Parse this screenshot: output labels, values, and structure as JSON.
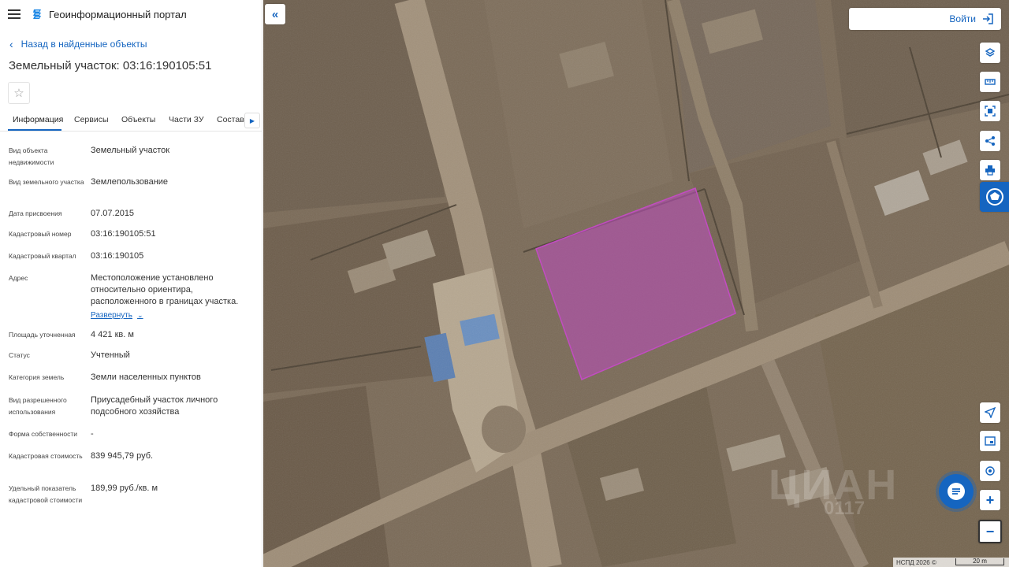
{
  "header": {
    "portal_title": "Геоинформационный портал"
  },
  "nav": {
    "back_label": "Назад в найденные объекты"
  },
  "parcel": {
    "title": "Земельный участок: 03:16:190105:51"
  },
  "tabs": [
    {
      "label": "Информация",
      "active": true
    },
    {
      "label": "Сервисы"
    },
    {
      "label": "Объекты"
    },
    {
      "label": "Части ЗУ"
    },
    {
      "label": "Состав"
    }
  ],
  "info": {
    "object_type": {
      "label": "Вид объекта недвижимости",
      "value": "Земельный участок"
    },
    "land_type": {
      "label": "Вид земельного участка",
      "value": "Землепользование"
    },
    "assign_date": {
      "label": "Дата присвоения",
      "value": "07.07.2015"
    },
    "cad_number": {
      "label": "Кадастровый номер",
      "value": "03:16:190105:51"
    },
    "cad_quarter": {
      "label": "Кадастровый квартал",
      "value": "03:16:190105"
    },
    "address": {
      "label": "Адрес",
      "value": "Местоположение установлено относительно ориентира, расположенного в границах участка.",
      "expand_label": "Развернуть"
    },
    "area": {
      "label": "Площадь уточненная",
      "value": "4 421 кв. м"
    },
    "status": {
      "label": "Статус",
      "value": "Учтенный"
    },
    "land_category": {
      "label": "Категория земель",
      "value": "Земли населенных пунктов"
    },
    "permitted_use": {
      "label": "Вид разрешенного использования",
      "value": "Приусадебный участок личного подсобного хозяйства"
    },
    "ownership": {
      "label": "Форма собственности",
      "value": "-"
    },
    "cad_value": {
      "label": "Кадастровая стоимость",
      "value": "839 945,79 руб."
    },
    "unit_value": {
      "label": "Удельный показатель кадастровой стоимости",
      "value": "189,99 руб./кв. м"
    }
  },
  "map": {
    "login_label": "Войти",
    "attribution": "НСПД 2026 ©",
    "scale_label": "20 m",
    "watermark": "ЦИАН",
    "watermark_id": "0117",
    "parcel_fill": "#b44fb3",
    "accent": "#1565c0"
  },
  "icons": {
    "tools": [
      "layers-icon",
      "ruler-icon",
      "select-area-icon",
      "share-icon",
      "print-icon",
      "cadastral-icon"
    ],
    "bottom_tools": [
      "navigate-icon",
      "minimap-icon",
      "geolocation-icon"
    ],
    "chat": "chat-icon",
    "zoom_in": "+",
    "zoom_out": "−"
  }
}
